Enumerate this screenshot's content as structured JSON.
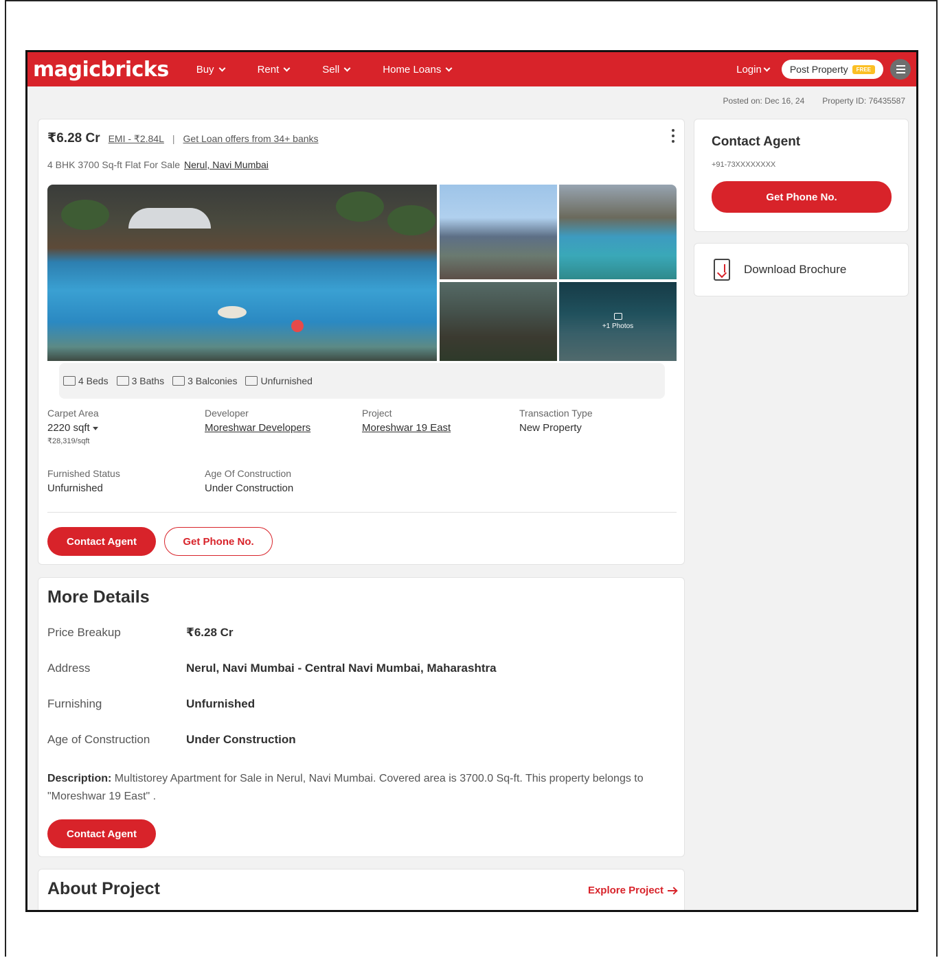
{
  "header": {
    "logo": "magicbricks",
    "nav": [
      "Buy",
      "Rent",
      "Sell",
      "Home Loans"
    ],
    "login": "Login",
    "post_property": "Post Property",
    "free_badge": "FREE"
  },
  "meta": {
    "posted_on": "Posted on: Dec 16, 24",
    "property_id": "Property ID: 76435587"
  },
  "listing": {
    "price": "₹6.28 Cr",
    "emi": "EMI - ₹2.84L",
    "separator": "|",
    "loan_offers": "Get Loan offers from 34+ banks",
    "subtitle": "4 BHK 3700 Sq-ft Flat For Sale",
    "location": "Nerul, Navi Mumbai",
    "photos_more": "+1 Photos",
    "features": [
      "4 Beds",
      "3 Baths",
      "3 Balconies",
      "Unfurnished"
    ],
    "specs": [
      {
        "label": "Carpet Area",
        "value": "2220 sqft",
        "sub": "₹28,319/sqft"
      },
      {
        "label": "Developer",
        "value": "Moreshwar Developers"
      },
      {
        "label": "Project",
        "value": "Moreshwar 19 East"
      },
      {
        "label": "Transaction Type",
        "value": "New Property"
      },
      {
        "label": "Furnished Status",
        "value": "Unfurnished"
      },
      {
        "label": "Age Of Construction",
        "value": "Under Construction"
      }
    ],
    "contact_agent": "Contact Agent",
    "get_phone": "Get Phone No."
  },
  "sidebar": {
    "title": "Contact Agent",
    "phone": "+91-73XXXXXXXX",
    "get_phone": "Get Phone No.",
    "download_brochure": "Download Brochure"
  },
  "more_details": {
    "title": "More Details",
    "rows": [
      {
        "label": "Price Breakup",
        "value": "₹6.28 Cr"
      },
      {
        "label": "Address",
        "value": "Nerul, Navi Mumbai - Central Navi Mumbai, Maharashtra"
      },
      {
        "label": "Furnishing",
        "value": "Unfurnished"
      },
      {
        "label": "Age of Construction",
        "value": "Under Construction"
      }
    ],
    "description_label": "Description:",
    "description": "Multistorey Apartment for Sale in Nerul, Navi Mumbai. Covered area is 3700.0 Sq-ft. This property belongs to \"Moreshwar 19 East\" .",
    "contact_agent": "Contact Agent"
  },
  "about_project": {
    "title": "About Project",
    "explore": "Explore Project"
  },
  "colors": {
    "brand_red": "#d8232a",
    "free_badge": "#fbbf24"
  }
}
